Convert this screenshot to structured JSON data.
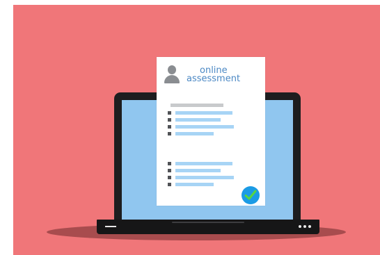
{
  "document": {
    "title_line1": "online",
    "title_line2": "assessment"
  },
  "icons": {
    "avatar": "user-avatar-icon",
    "check": "checkmark-icon"
  },
  "colors": {
    "background": "#f07679",
    "screen": "#90c6ef",
    "title_text": "#4b88c4",
    "check_circle": "#1b9be5",
    "check_mark": "#57d640"
  }
}
